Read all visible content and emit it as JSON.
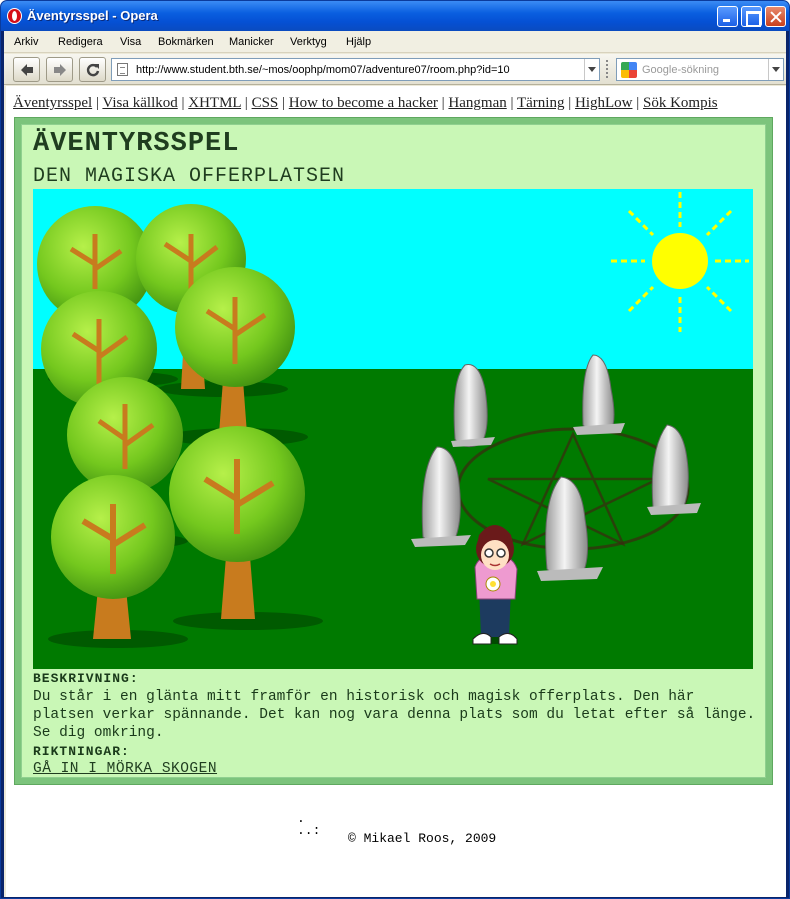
{
  "window": {
    "title": "Äventyrsspel - Opera"
  },
  "menu": [
    "Arkiv",
    "Redigera",
    "Visa",
    "Bokmärken",
    "Manicker",
    "Verktyg",
    "Hjälp"
  ],
  "address": {
    "url": "http://www.student.bth.se/~mos/oophp/mom07/adventure07/room.php?id=10"
  },
  "search": {
    "placeholder": "Google-sökning"
  },
  "site_links": [
    "Äventyrsspel",
    "Visa källkod",
    "XHTML",
    "CSS",
    "How to become a hacker",
    "Hangman",
    "Tärning",
    "HighLow",
    "Sök Kompis"
  ],
  "game": {
    "title": "ÄVENTYRSSPEL",
    "room_title": "DEN MAGISKA OFFERPLATSEN",
    "description_label": "BESKRIVNING:",
    "description": "Du står i en glänta mitt framför en historisk och magisk offerplats. Den här platsen verkar spännande. Det kan nog vara denna plats som du letat efter så länge. Se dig omkring.",
    "directions_label": "RIKTNINGAR:",
    "directions": [
      "GÅ IN I MÖRKA SKOGEN"
    ]
  },
  "footer": {
    "dots": ".\n..:",
    "copyright": "© Mikael Roos, 2009"
  },
  "colors": {
    "sky": "#00ffff",
    "grass": "#007a00",
    "sun": "#ffff00",
    "panel_bg": "#c9f7b6",
    "panel_border": "#7cc47c"
  }
}
